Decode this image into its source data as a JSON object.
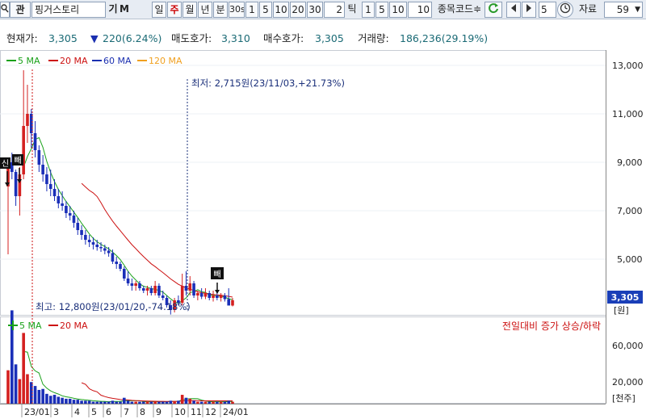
{
  "toolbar": {
    "search_icon": "search-icon",
    "pin_label": "관",
    "stock_name": "핑거스토리",
    "gi_label": "기",
    "m_label": "M",
    "period_tabs": [
      "일",
      "주",
      "월",
      "년"
    ],
    "active_period": "주",
    "minute_label": "분",
    "sec_label": "30s",
    "minute_options": [
      "1",
      "5",
      "10",
      "20",
      "30"
    ],
    "minute_input": "2",
    "tick_label": "틱",
    "tick_options": [
      "1",
      "5",
      "10"
    ],
    "tick_input": "10",
    "code_label": "종목코드≑",
    "count_input": "5",
    "data_label": "자료",
    "data_value": "59",
    "colors": {
      "selected": "#cc0000",
      "refresh": "#2a9a2a"
    }
  },
  "info": {
    "price_label": "현재가:",
    "price_value": "3,305",
    "change_value": "220(6.24%)",
    "ask_label": "매도호가:",
    "ask_value": "3,310",
    "bid_label": "매수호가:",
    "bid_value": "3,305",
    "volume_label": "거래량:",
    "volume_value": "186,236(29.19%)"
  },
  "price_panel": {
    "legend": [
      {
        "label": "5 MA",
        "color": "#1aa11a"
      },
      {
        "label": "20 MA",
        "color": "#cc1111"
      },
      {
        "label": "60 MA",
        "color": "#1a2fb0"
      },
      {
        "label": "120 MA",
        "color": "#f0a020"
      }
    ],
    "y_ticks": [
      "13,000",
      "11,000",
      "9,000",
      "7,000",
      "5,000"
    ],
    "unit": "[원]",
    "current_price_badge": "3,305",
    "low_annotation": "최저: 2,715원(23/11/03,+21.73%)",
    "high_annotation": "최고: 12,800원(23/01/20,-74.18%)",
    "event_markers": [
      "신",
      "빼",
      "빼"
    ]
  },
  "volume_panel": {
    "legend": [
      {
        "label": "5 MA",
        "color": "#1aa11a"
      },
      {
        "label": "20 MA",
        "color": "#cc1111"
      }
    ],
    "note": "전일대비 증가 상승/하락",
    "y_ticks": [
      "60,000",
      "20,000"
    ],
    "unit": "[천주]"
  },
  "x_axis": {
    "labels": [
      "23/01",
      "3",
      "4",
      "5",
      "6",
      "7",
      "8",
      "9",
      "10",
      "11",
      "12",
      "24/01"
    ]
  },
  "chart_data": {
    "type": "candlestick",
    "period": "weekly",
    "x_labels": [
      "23/01",
      "3",
      "4",
      "5",
      "6",
      "7",
      "8",
      "9",
      "10",
      "11",
      "12",
      "24/01"
    ],
    "ylim_price": [
      2500,
      13500
    ],
    "ohlc": [
      [
        8000,
        9000,
        5200,
        8800
      ],
      [
        9000,
        9400,
        8300,
        8600
      ],
      [
        8600,
        8700,
        7200,
        7600
      ],
      [
        7600,
        8800,
        6800,
        8500
      ],
      [
        8500,
        12800,
        8300,
        10500
      ],
      [
        10500,
        12200,
        9800,
        11000
      ],
      [
        11000,
        11200,
        9600,
        10200
      ],
      [
        10200,
        10700,
        9200,
        9500
      ],
      [
        9500,
        9700,
        8600,
        8900
      ],
      [
        8900,
        9300,
        8200,
        8500
      ],
      [
        8500,
        8800,
        7800,
        8100
      ],
      [
        8100,
        8700,
        7600,
        7900
      ],
      [
        7900,
        8300,
        7400,
        7600
      ],
      [
        7600,
        7900,
        7100,
        7300
      ],
      [
        7300,
        7800,
        7000,
        7200
      ],
      [
        7200,
        7400,
        6700,
        6900
      ],
      [
        6900,
        7200,
        6600,
        6800
      ],
      [
        6800,
        7000,
        6300,
        6500
      ],
      [
        6500,
        6700,
        6000,
        6200
      ],
      [
        6200,
        6400,
        5800,
        6000
      ],
      [
        6000,
        6200,
        5600,
        5800
      ],
      [
        5800,
        6000,
        5500,
        5700
      ],
      [
        5700,
        5900,
        5400,
        5600
      ],
      [
        5600,
        5800,
        5350,
        5500
      ],
      [
        5500,
        5700,
        5300,
        5450
      ],
      [
        5450,
        5600,
        5200,
        5350
      ],
      [
        5350,
        5500,
        5100,
        5250
      ],
      [
        5250,
        5400,
        4800,
        4900
      ],
      [
        4900,
        5100,
        4600,
        4800
      ],
      [
        4800,
        4900,
        4500,
        4600
      ],
      [
        4600,
        4700,
        4100,
        4200
      ],
      [
        4200,
        4500,
        3900,
        4000
      ],
      [
        4000,
        4200,
        3700,
        3900
      ],
      [
        3900,
        4100,
        3700,
        4000
      ],
      [
        4000,
        4100,
        3700,
        3800
      ],
      [
        3800,
        3900,
        3600,
        3700
      ],
      [
        3700,
        3900,
        3500,
        3800
      ],
      [
        3800,
        3900,
        3500,
        3600
      ],
      [
        3600,
        4100,
        3500,
        3900
      ],
      [
        3900,
        4000,
        3400,
        3500
      ],
      [
        3500,
        3700,
        3300,
        3400
      ],
      [
        3400,
        3500,
        3000,
        3100
      ],
      [
        3100,
        3300,
        2715,
        2900
      ],
      [
        2900,
        3400,
        2800,
        3300
      ],
      [
        3300,
        3500,
        3100,
        3200
      ],
      [
        3200,
        4400,
        3100,
        3900
      ],
      [
        3900,
        4500,
        3500,
        3700
      ],
      [
        3700,
        4300,
        3500,
        4000
      ],
      [
        4000,
        4100,
        3400,
        3500
      ],
      [
        3500,
        3700,
        3300,
        3600
      ],
      [
        3600,
        3800,
        3350,
        3450
      ],
      [
        3450,
        3800,
        3350,
        3600
      ],
      [
        3600,
        3700,
        3300,
        3400
      ],
      [
        3400,
        3700,
        3250,
        3500
      ],
      [
        3500,
        3650,
        3300,
        3400
      ],
      [
        3400,
        3600,
        3250,
        3500
      ],
      [
        3500,
        3600,
        3250,
        3350
      ],
      [
        3350,
        3800,
        3250,
        3085
      ],
      [
        3085,
        3400,
        3050,
        3305
      ]
    ],
    "volume": [
      34,
      95,
      40,
      25,
      72,
      30,
      22,
      18,
      14,
      15,
      10,
      8,
      9,
      7,
      6,
      5,
      5,
      4,
      4,
      3,
      3,
      3,
      2,
      2,
      2,
      2,
      2,
      3,
      2,
      2,
      6,
      3,
      2,
      2,
      2,
      2,
      2,
      2,
      2,
      2,
      2,
      2,
      3,
      2,
      3,
      9,
      6,
      5,
      3,
      2,
      2,
      2,
      2,
      2,
      2,
      2,
      2,
      3,
      2
    ],
    "volume_unit": "천주",
    "current_price": 3305,
    "high": {
      "value": 12800,
      "date": "23/01/20"
    },
    "low": {
      "value": 2715,
      "date": "23/11/03"
    }
  }
}
